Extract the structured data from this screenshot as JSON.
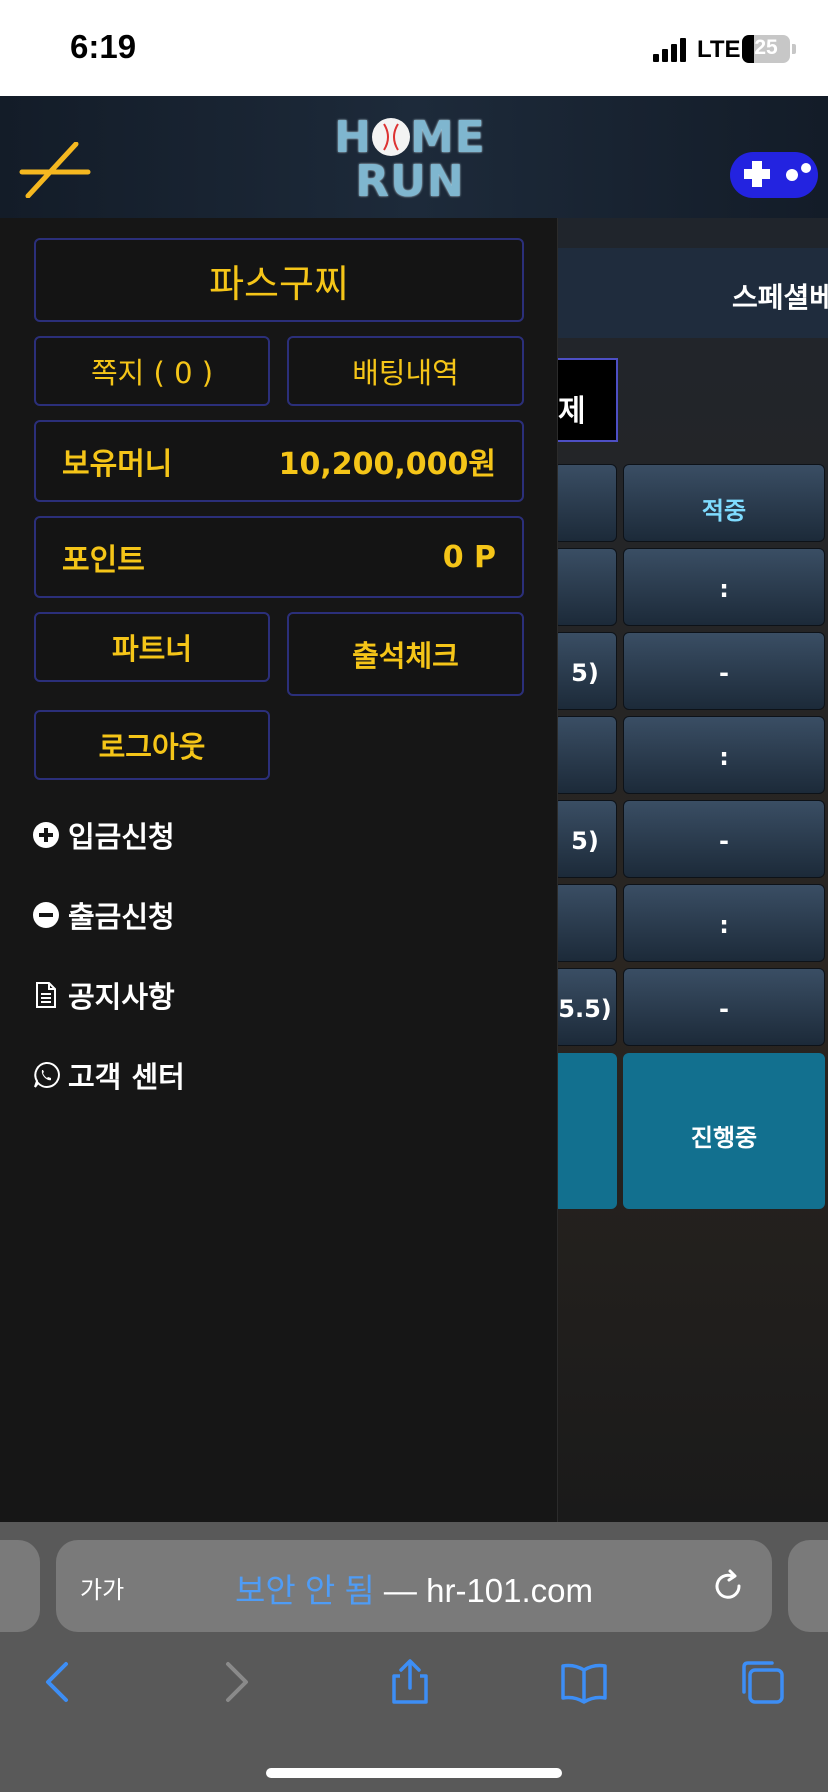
{
  "status_bar": {
    "time": "6:19",
    "network": "LTE",
    "battery": "25"
  },
  "header": {
    "logo_line1": [
      "H",
      "ME"
    ],
    "logo_line2": "RUN"
  },
  "background": {
    "special_tab": "스페셜베",
    "tab_fragment": "제",
    "hit_header": "적중",
    "left_partials": [
      "",
      "5)",
      "",
      "5)",
      "",
      "5.5)"
    ],
    "right_values": [
      ":",
      "-",
      ":",
      "-",
      ":",
      "-"
    ],
    "status_label": "진행중"
  },
  "drawer": {
    "username": "파스구찌",
    "message_button": "쪽지 ( 0 )",
    "betting_history_button": "배팅내역",
    "money_label": "보유머니",
    "money_value": "10,200,000원",
    "point_label": "포인트",
    "point_value": "0 P",
    "partner_button": "파트너",
    "attendance_button": "출석체크",
    "logout_button": "로그아웃",
    "menu": {
      "deposit": "입금신청",
      "withdraw": "출금신청",
      "notice": "공지사항",
      "support": "고객 센터"
    }
  },
  "safari": {
    "aa_label": "가가",
    "insecure_label": "보안 안 됨",
    "separator": " — ",
    "domain": "hr-101.com"
  }
}
